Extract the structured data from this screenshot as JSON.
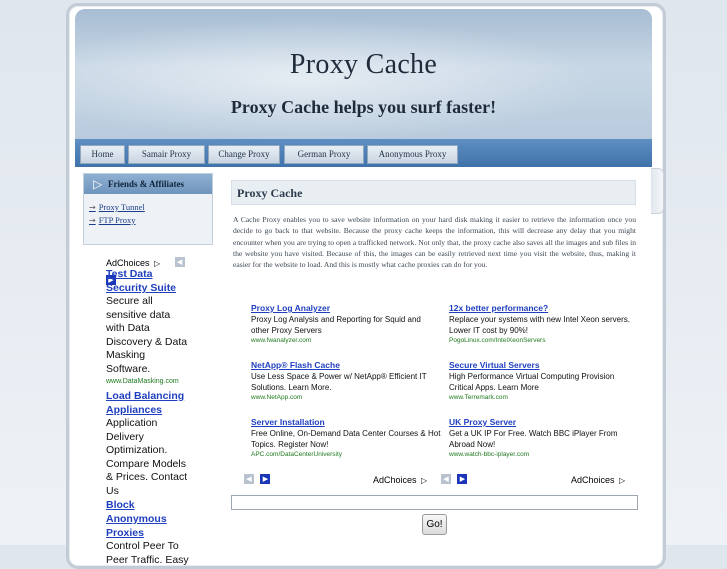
{
  "header": {
    "title": "Proxy Cache",
    "tagline": "Proxy Cache helps you surf faster!"
  },
  "nav": {
    "tabs": [
      {
        "label": "Home"
      },
      {
        "label": "Samair Proxy"
      },
      {
        "label": "Change Proxy"
      },
      {
        "label": "German Proxy"
      },
      {
        "label": "Anonymous Proxy"
      }
    ]
  },
  "sidebar": {
    "heading": "Friends & Affiliates",
    "links": [
      {
        "label": "Proxy Tunnel"
      },
      {
        "label": "FTP Proxy"
      }
    ]
  },
  "side_ads": {
    "adchoices": "AdChoices",
    "items": [
      {
        "title": "Test Data Security Suite",
        "desc": "Secure all sensitive data with Data Discovery & Data Masking Software.",
        "url": "www.DataMasking.com"
      },
      {
        "title": "Load Balancing Appliances",
        "desc": "Application Delivery Optimization. Compare Models & Prices. Contact Us",
        "url": ""
      },
      {
        "title": "Block Anonymous Proxies",
        "desc": "Control Peer To Peer Traffic. Easy",
        "url": ""
      }
    ]
  },
  "main": {
    "title": "Proxy Cache",
    "body": "A Cache Proxy enables you to save website information on your hard disk making it easier to retrieve the information once you decide to go back to that website. Because the proxy cache keeps the information, this will decrease any delay that you might encounter when you are trying to open a trafficked network. Not only that, the proxy cache also saves all the images and sub files in the website you have visited. Because of this, the images can be easily retrieved next time you visit the website, thus, making it easier for the website to load. And this is mostly what cache proxies can do for you."
  },
  "ads": {
    "adchoices": "AdChoices",
    "left": [
      {
        "title": "Proxy Log Analyzer",
        "desc": "Proxy Log Analysis and Reporting for Squid and other Proxy Servers",
        "url": "www.fwanalyzer.com"
      },
      {
        "title": "NetApp® Flash Cache",
        "desc": "Use Less Space & Power w/ NetApp® Efficient IT Solutions. Learn More.",
        "url": "www.NetApp.com"
      },
      {
        "title": "Server Installation",
        "desc": "Free Online, On-Demand Data Center Courses & Hot Topics. Register Now!",
        "url": "APC.com/DataCenterUniversity"
      }
    ],
    "right": [
      {
        "title": "12x better performance?",
        "desc": "Replace your systems with new Intel Xeon servers. Lower IT cost by 90%!",
        "url": "PogoLinux.com/IntelXeonServers"
      },
      {
        "title": "Secure Virtual Servers",
        "desc": "High Performance Virtual Computing Provision Critical Apps. Learn More",
        "url": "www.Terremark.com"
      },
      {
        "title": "UK Proxy Server",
        "desc": "Get a UK IP For Free. Watch BBC iPlayer From Abroad Now!",
        "url": "www.watch-bbc-iplayer.com"
      }
    ]
  },
  "search": {
    "value": "",
    "go_label": "Go!"
  },
  "colors": {
    "nav_bar": "#4a7db4",
    "ad_link": "#1f3fbf",
    "ad_url": "#1f7a1f"
  },
  "icons": {
    "adchoices": "adchoices-triangle-icon",
    "prev": "arrow-left-icon",
    "next": "arrow-right-icon",
    "sidebar_chevron": "chevron-right-icon"
  }
}
